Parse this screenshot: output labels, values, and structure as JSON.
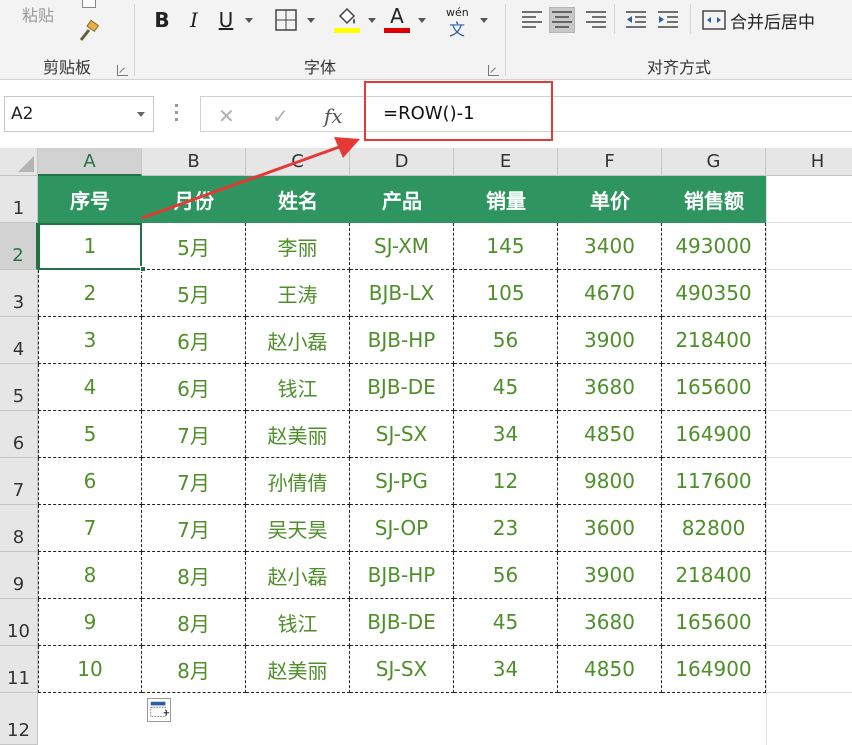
{
  "ribbon": {
    "clipboard": {
      "paste_label": "粘贴",
      "group_label": "剪贴板"
    },
    "font": {
      "group_label": "字体",
      "bold": "B",
      "italic": "I",
      "underline": "U",
      "font_color_letter": "A",
      "phonetic_top": "wén",
      "phonetic_bottom": "文",
      "fill_color": "#ffff00",
      "font_color": "#e00000"
    },
    "alignment": {
      "group_label": "对齐方式",
      "merge_label": "合并后居中"
    }
  },
  "formula_bar": {
    "name_box": "A2",
    "cancel": "✕",
    "enter": "✓",
    "fx": "fx",
    "formula": "=ROW()-1"
  },
  "columns": [
    "A",
    "B",
    "C",
    "D",
    "E",
    "F",
    "G",
    "H"
  ],
  "rows": [
    "1",
    "2",
    "3",
    "4",
    "5",
    "6",
    "7",
    "8",
    "9",
    "10",
    "11",
    "12"
  ],
  "table": {
    "headers": [
      "序号",
      "月份",
      "姓名",
      "产品",
      "销量",
      "单价",
      "销售额"
    ],
    "rows": [
      [
        "1",
        "5月",
        "李丽",
        "SJ-XM",
        "145",
        "3400",
        "493000"
      ],
      [
        "2",
        "5月",
        "王涛",
        "BJB-LX",
        "105",
        "4670",
        "490350"
      ],
      [
        "3",
        "6月",
        "赵小磊",
        "BJB-HP",
        "56",
        "3900",
        "218400"
      ],
      [
        "4",
        "6月",
        "钱江",
        "BJB-DE",
        "45",
        "3680",
        "165600"
      ],
      [
        "5",
        "7月",
        "赵美丽",
        "SJ-SX",
        "34",
        "4850",
        "164900"
      ],
      [
        "6",
        "7月",
        "孙倩倩",
        "SJ-PG",
        "12",
        "9800",
        "117600"
      ],
      [
        "7",
        "7月",
        "吴天昊",
        "SJ-OP",
        "23",
        "3600",
        "82800"
      ],
      [
        "8",
        "8月",
        "赵小磊",
        "BJB-HP",
        "56",
        "3900",
        "218400"
      ],
      [
        "9",
        "8月",
        "钱江",
        "BJB-DE",
        "45",
        "3680",
        "165600"
      ],
      [
        "10",
        "8月",
        "赵美丽",
        "SJ-SX",
        "34",
        "4850",
        "164900"
      ]
    ]
  },
  "colors": {
    "header_fill": "#2e9561",
    "cell_text": "#4e8f2a",
    "highlight": "#e53935",
    "selection": "#217346"
  }
}
